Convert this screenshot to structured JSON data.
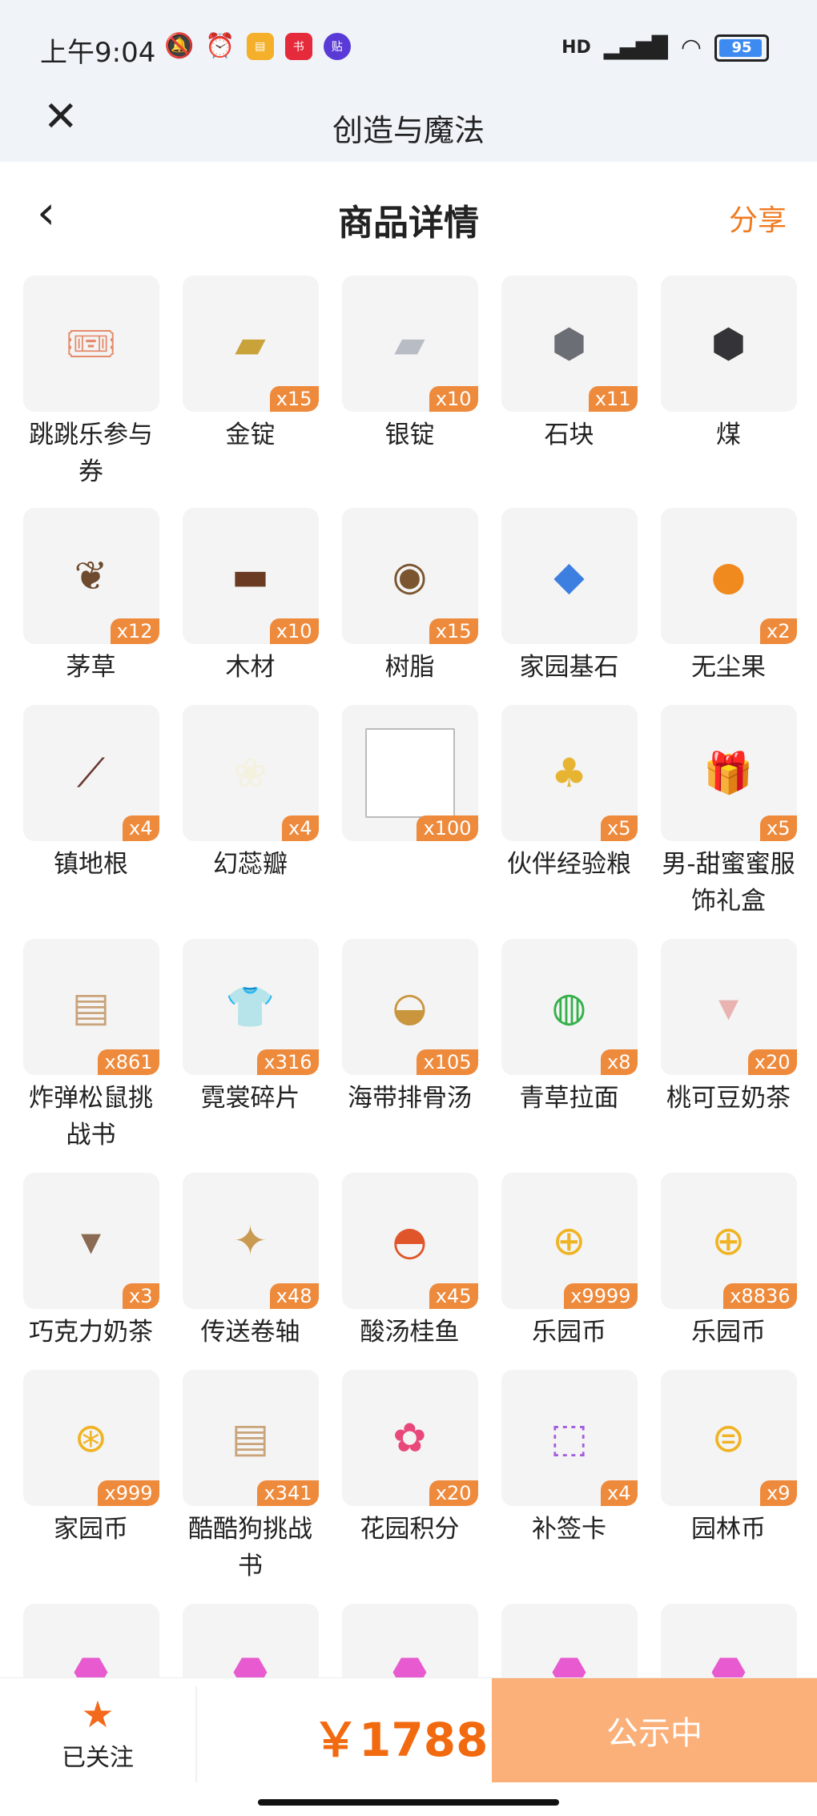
{
  "status_bar": {
    "time": "上午9:04",
    "network": "HD",
    "battery": "95"
  },
  "app": {
    "title": "创造与魔法"
  },
  "page": {
    "title": "商品详情",
    "share": "分享"
  },
  "items": [
    {
      "name": "跳跳乐参与券",
      "count": "",
      "icon": "ticket-icon",
      "color": "#e58a6a"
    },
    {
      "name": "金锭",
      "count": "x15",
      "icon": "gold-ingot-icon",
      "color": "#c9a23a"
    },
    {
      "name": "银锭",
      "count": "x10",
      "icon": "silver-ingot-icon",
      "color": "#b8bcc4"
    },
    {
      "name": "石块",
      "count": "x11",
      "icon": "stone-icon",
      "color": "#6b6e75"
    },
    {
      "name": "煤",
      "count": "",
      "icon": "coal-icon",
      "color": "#333338"
    },
    {
      "name": "茅草",
      "count": "x12",
      "icon": "thatch-icon",
      "color": "#6e4b2f"
    },
    {
      "name": "木材",
      "count": "x10",
      "icon": "wood-icon",
      "color": "#6a3a22"
    },
    {
      "name": "树脂",
      "count": "x15",
      "icon": "resin-icon",
      "color": "#7a5530"
    },
    {
      "name": "家园基石",
      "count": "",
      "icon": "crystal-icon",
      "color": "#3d7fe0"
    },
    {
      "name": "无尘果",
      "count": "x2",
      "icon": "fruit-icon",
      "color": "#f08a1e"
    },
    {
      "name": "镇地根",
      "count": "x4",
      "icon": "root-icon",
      "color": "#6a3a30"
    },
    {
      "name": "幻蕊瓣",
      "count": "x4",
      "icon": "petal-icon",
      "color": "#f4f1df"
    },
    {
      "name": "",
      "count": "x100",
      "icon": "broken-image-icon",
      "color": "#ffffff"
    },
    {
      "name": "伙伴经验粮",
      "count": "x5",
      "icon": "pet-food-bag-icon",
      "color": "#e7b431"
    },
    {
      "name": "男-甜蜜蜜服饰礼盒",
      "count": "x5",
      "icon": "gift-box-icon",
      "color": "#f2a8c0"
    },
    {
      "name": "炸弹松鼠挑战书",
      "count": "x861",
      "icon": "wanted-scroll-icon",
      "color": "#c9a37a"
    },
    {
      "name": "霓裳碎片",
      "count": "x316",
      "icon": "shirt-icon",
      "color": "#f3c520"
    },
    {
      "name": "海带排骨汤",
      "count": "x105",
      "icon": "soup-icon",
      "color": "#c9963d"
    },
    {
      "name": "青草拉面",
      "count": "x8",
      "icon": "noodle-icon",
      "color": "#34b04a"
    },
    {
      "name": "桃可豆奶茶",
      "count": "x20",
      "icon": "milk-tea-icon",
      "color": "#e8b3b0"
    },
    {
      "name": "巧克力奶茶",
      "count": "x3",
      "icon": "chocolate-tea-icon",
      "color": "#8a6a52"
    },
    {
      "name": "传送卷轴",
      "count": "x48",
      "icon": "scroll-icon",
      "color": "#c99a50"
    },
    {
      "name": "酸汤桂鱼",
      "count": "x45",
      "icon": "fish-dish-icon",
      "color": "#e0552a"
    },
    {
      "name": "乐园币",
      "count": "x9999",
      "icon": "coin-icon",
      "color": "#f0b322"
    },
    {
      "name": "乐园币",
      "count": "x8836",
      "icon": "coin-icon",
      "color": "#f0b322"
    },
    {
      "name": "家园币",
      "count": "x999",
      "icon": "home-coin-icon",
      "color": "#f0b322"
    },
    {
      "name": "酷酷狗挑战书",
      "count": "x341",
      "icon": "wanted-scroll-icon",
      "color": "#c9a37a"
    },
    {
      "name": "花园积分",
      "count": "x20",
      "icon": "flower-icon",
      "color": "#e8487a"
    },
    {
      "name": "补签卡",
      "count": "x4",
      "icon": "ticket-card-icon",
      "color": "#a45be0"
    },
    {
      "name": "园林币",
      "count": "x9",
      "icon": "garden-coin-icon",
      "color": "#f0b322"
    },
    {
      "name": "",
      "count": "",
      "icon": "pink-gem-icon",
      "color": "#e85ad0"
    },
    {
      "name": "",
      "count": "",
      "icon": "pink-gem-icon",
      "color": "#e85ad0"
    },
    {
      "name": "",
      "count": "",
      "icon": "pink-gem-icon",
      "color": "#e85ad0"
    },
    {
      "name": "",
      "count": "",
      "icon": "pink-gem-icon",
      "color": "#e85ad0"
    },
    {
      "name": "",
      "count": "",
      "icon": "pink-gem-icon",
      "color": "#e85ad0"
    }
  ],
  "bottom": {
    "follow_label": "已关注",
    "price": "￥1788",
    "status": "公示中"
  }
}
